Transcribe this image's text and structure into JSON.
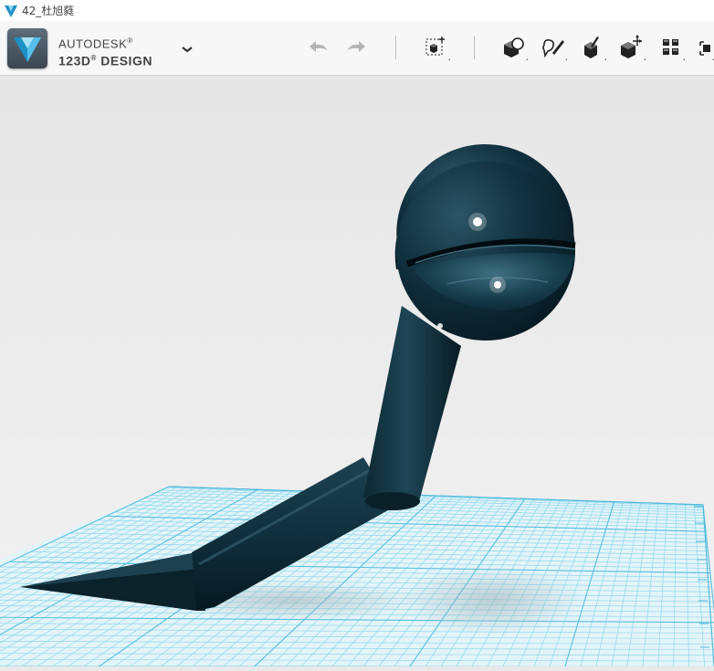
{
  "window": {
    "title": "42_杜旭蕤"
  },
  "brand": {
    "line1": "AUTODESK",
    "line2": "123D",
    "line2_suffix": " DESIGN",
    "reg_mark": "®"
  },
  "toolbar": {
    "icons": [
      "undo-icon",
      "redo-icon",
      "transform-box-icon",
      "primitives-icon",
      "sketch-icon",
      "construct-icon",
      "modify-icon",
      "pattern-icon",
      "grouping-icon"
    ]
  },
  "colors": {
    "accent": "#3fb3e0",
    "model": "#0f2a35",
    "grid": "#7fd3ea",
    "background": "#e9e9e9"
  }
}
